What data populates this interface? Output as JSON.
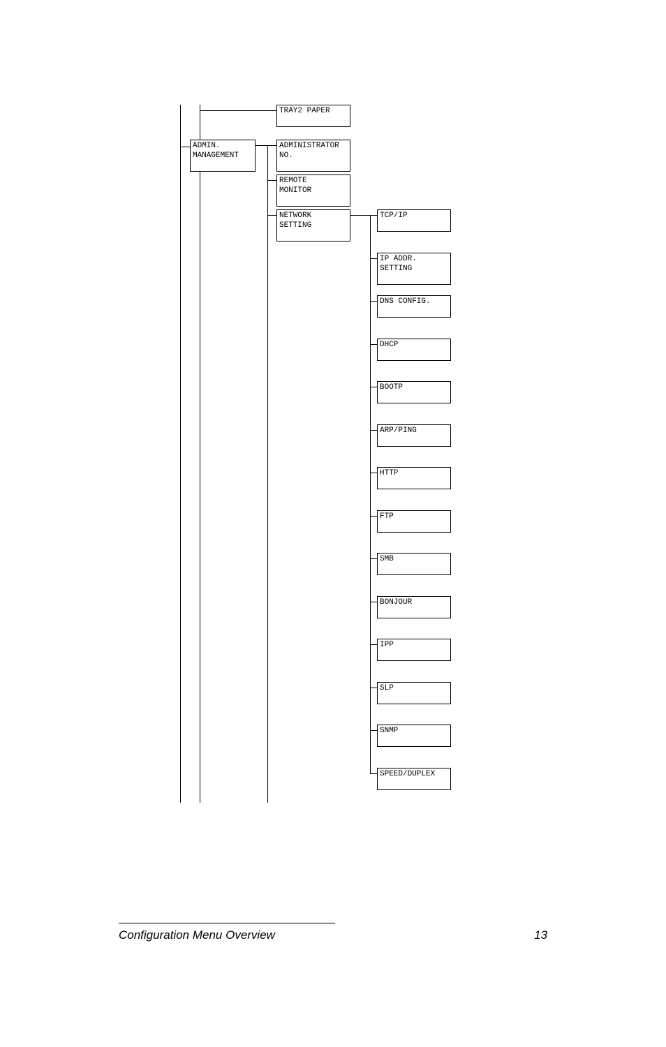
{
  "tree": {
    "col1": {
      "admin_management": "ADMIN.\nMANAGEMENT"
    },
    "col2": {
      "tray2_paper": "TRAY2 PAPER",
      "administrator_no": "ADMINISTRATOR\nNO.",
      "remote_monitor": "REMOTE\nMONITOR",
      "network_setting": "NETWORK\nSETTING"
    },
    "col3": {
      "tcp_ip": "TCP/IP",
      "ip_addr_setting": "IP ADDR.\nSETTING",
      "dns_config": "DNS CONFIG.",
      "dhcp": "DHCP",
      "bootp": "BOOTP",
      "arp_ping": "ARP/PING",
      "http": "HTTP",
      "ftp": "FTP",
      "smb": "SMB",
      "bonjour": "BONJOUR",
      "ipp": "IPP",
      "slp": "SLP",
      "snmp": "SNMP",
      "speed_duplex": "SPEED/DUPLEX"
    }
  },
  "footer": {
    "title": "Configuration Menu Overview",
    "page": "13"
  }
}
